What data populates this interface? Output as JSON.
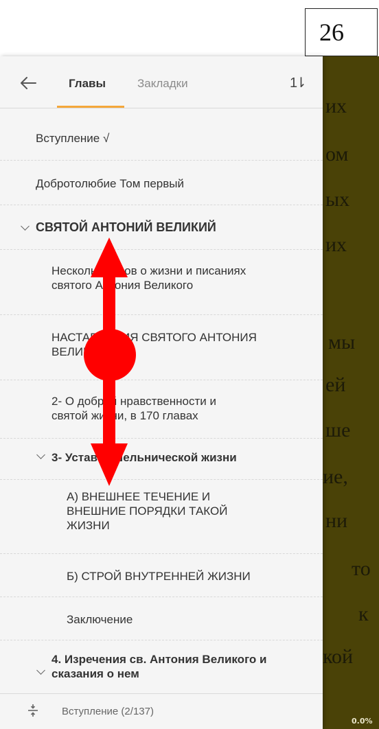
{
  "page_badge": "26",
  "reader": {
    "fragments": [
      "их",
      "ом",
      "ых",
      "их",
      "мы",
      "ей",
      "ше",
      "ие,",
      "ни",
      "то",
      "к",
      "кой"
    ],
    "progress": "0.0%"
  },
  "drawer": {
    "tabs": {
      "chapters": "Главы",
      "bookmarks": "Закладки"
    },
    "sort_glyph": "1⇂",
    "items": [
      {
        "label": "Вступление √"
      },
      {
        "label": "Добротолюбие Том первый"
      },
      {
        "label": "СВЯТОЙ АНТОНИЙ ВЕЛИКИЙ"
      },
      {
        "label_line1": "Несколько слов о жизни и писаниях",
        "label_line2": "святого Антония Великого"
      },
      {
        "label_line1": "НАСТАВЛЕНИЯ СВЯТОГО АНТОНИЯ",
        "label_line2": "ВЕЛИКОГО"
      },
      {
        "label_line1": "2- О доброй нравственности и",
        "label_line2": "святой жизни, в 170 главах"
      },
      {
        "label": "3- Устав отшельнической жизни"
      },
      {
        "label_line1": "А) ВНЕШНЕЕ ТЕЧЕНИЕ И",
        "label_line2": "ВНЕШНИЕ ПОРЯДКИ ТАКОЙ",
        "label_line3": "ЖИЗНИ"
      },
      {
        "label": "Б) СТРОЙ ВНУТРЕННЕЙ ЖИЗНИ"
      },
      {
        "label": "Заключение"
      },
      {
        "label_line1": "4. Изречения св. Антония Великого и",
        "label_line2": "сказания о нем"
      }
    ],
    "footer": {
      "current": "Вступление (2/137)"
    }
  },
  "colors": {
    "accent": "#f4a73a",
    "reader_bg": "#4a4207",
    "gesture": "#ff0000"
  }
}
